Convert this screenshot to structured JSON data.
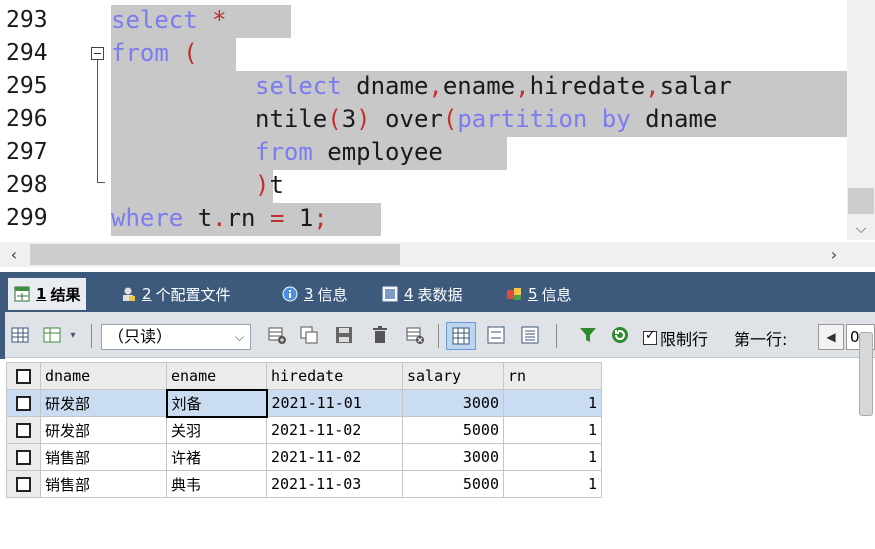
{
  "editor": {
    "lines": [
      {
        "num": "293",
        "code": [
          {
            "t": "select",
            "c": "kw"
          },
          {
            "t": " "
          },
          {
            "t": "*",
            "c": "op"
          }
        ]
      },
      {
        "num": "294",
        "code": [
          {
            "t": "from",
            "c": "kw"
          },
          {
            "t": " "
          },
          {
            "t": "(",
            "c": "op"
          }
        ]
      },
      {
        "num": "295",
        "code": [
          {
            "t": "select",
            "c": "kw"
          },
          {
            "t": " dname"
          },
          {
            "t": ",",
            "c": "op"
          },
          {
            "t": "ename"
          },
          {
            "t": ",",
            "c": "op"
          },
          {
            "t": "hiredate"
          },
          {
            "t": ",",
            "c": "op"
          },
          {
            "t": "salar"
          }
        ]
      },
      {
        "num": "296",
        "code": [
          {
            "t": "ntile"
          },
          {
            "t": "(",
            "c": "op"
          },
          {
            "t": "3"
          },
          {
            "t": ")",
            "c": "op"
          },
          {
            "t": " over"
          },
          {
            "t": "(",
            "c": "op"
          },
          {
            "t": "partition by",
            "c": "kw"
          },
          {
            "t": " dname"
          }
        ]
      },
      {
        "num": "297",
        "code": [
          {
            "t": "from",
            "c": "kw"
          },
          {
            "t": " employee"
          }
        ]
      },
      {
        "num": "298",
        "code": [
          {
            "t": ")",
            "c": "op"
          },
          {
            "t": "t"
          }
        ]
      },
      {
        "num": "299",
        "code": [
          {
            "t": "where",
            "c": "kw"
          },
          {
            "t": " t"
          },
          {
            "t": ".",
            "c": "op"
          },
          {
            "t": "rn "
          },
          {
            "t": "=",
            "c": "op"
          },
          {
            "t": " 1"
          },
          {
            "t": ";",
            "c": "op"
          }
        ]
      }
    ]
  },
  "tabs": [
    {
      "num": "1",
      "label": "结果",
      "icon": "result-grid-icon",
      "active": true
    },
    {
      "num": "2",
      "label": "个配置文件",
      "icon": "profile-icon",
      "active": false
    },
    {
      "num": "3",
      "label": "信息",
      "icon": "info-icon",
      "active": false
    },
    {
      "num": "4",
      "label": "表数据",
      "icon": "table-data-icon",
      "active": false
    },
    {
      "num": "5",
      "label": "信息",
      "icon": "info-flag-icon",
      "active": false
    }
  ],
  "toolbar": {
    "mode": "（只读）",
    "limit_rows_label": "限制行",
    "limit_rows_checked": true,
    "first_row_label": "第一行:",
    "first_row_value": "0"
  },
  "results": {
    "columns": [
      "dname",
      "ename",
      "hiredate",
      "salary",
      "rn"
    ],
    "rows": [
      [
        "研发部",
        "刘备",
        "2021-11-01",
        "3000",
        "1"
      ],
      [
        "研发部",
        "关羽",
        "2021-11-02",
        "5000",
        "1"
      ],
      [
        "销售部",
        "许褚",
        "2021-11-02",
        "3000",
        "1"
      ],
      [
        "销售部",
        "典韦",
        "2021-11-03",
        "5000",
        "1"
      ]
    ],
    "selected_row": 0
  },
  "colors": {
    "keyword": "#7a7cf0",
    "operator": "#c0302a",
    "selection_highlight": "#c8c8c8",
    "panel_header": "#3d5a7d",
    "selected_row": "#cadcf2"
  }
}
